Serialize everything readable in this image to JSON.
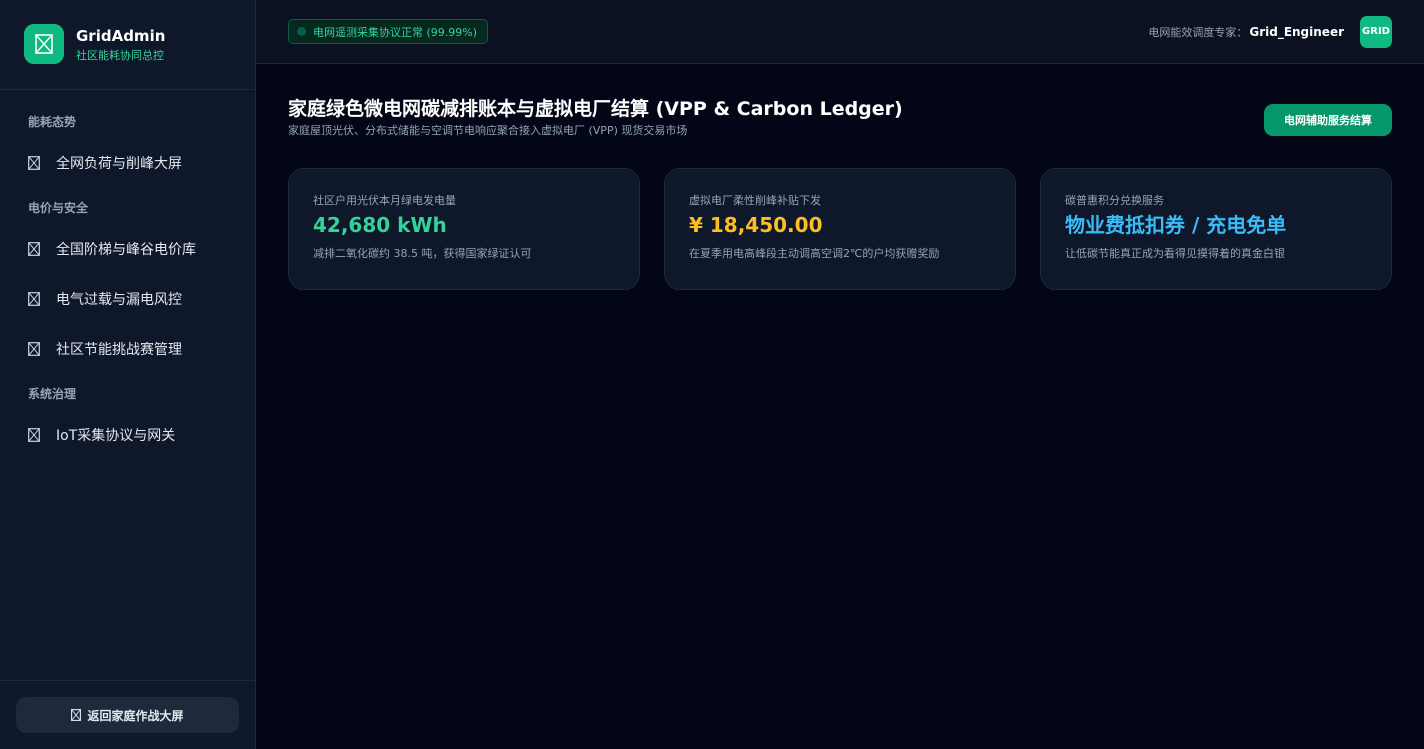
{
  "brand": {
    "name": "GridAdmin",
    "subtitle": "社区能耗协同总控",
    "logo_icon": "grid-icon"
  },
  "nav": {
    "sections": [
      {
        "title": "能耗态势",
        "items": [
          {
            "label": "全网负荷与削峰大屏",
            "icon": "broken-image-icon"
          }
        ]
      },
      {
        "title": "电价与安全",
        "items": [
          {
            "label": "全国阶梯与峰谷电价库",
            "icon": "broken-image-icon"
          },
          {
            "label": "电气过载与漏电风控",
            "icon": "broken-image-icon"
          },
          {
            "label": "社区节能挑战赛管理",
            "icon": "broken-image-icon"
          }
        ]
      },
      {
        "title": "系统治理",
        "items": [
          {
            "label": "IoT采集协议与网关",
            "icon": "broken-image-icon"
          }
        ]
      }
    ]
  },
  "footer": {
    "back_label": "返回家庭作战大屏"
  },
  "topbar": {
    "status_text": "电网遥测采集协议正常 (99.99%)",
    "user_role": "电网能效调度专家：",
    "user_name": "Grid_Engineer",
    "avatar_text": "GRID"
  },
  "page": {
    "title": "家庭绿色微电网碳减排账本与虚拟电厂结算 (VPP & Carbon Ledger)",
    "subtitle": "家庭屋顶光伏、分布式储能与空调节电响应聚合接入虚拟电厂 (VPP) 现货交易市场",
    "action_label": "电网辅助服务结算"
  },
  "cards": [
    {
      "label": "社区户用光伏本月绿电发电量",
      "value": "42,680 kWh",
      "note": "减排二氧化碳约 38.5 吨，获得国家绿证认可",
      "color": "#34d399"
    },
    {
      "label": "虚拟电厂柔性削峰补贴下发",
      "value": "¥ 18,450.00",
      "note": "在夏季用电高峰段主动调高空调2℃的户均获赠奖励",
      "color": "#fbbf24"
    },
    {
      "label": "碳普惠积分兑换服务",
      "value": "物业费抵扣券 / 充电免单",
      "note": "让低碳节能真正成为看得见摸得着的真金白银",
      "color": "#38bdf8"
    }
  ],
  "colors": {
    "accent": "#10b981",
    "background": "#020617",
    "panel": "#0f172a"
  }
}
